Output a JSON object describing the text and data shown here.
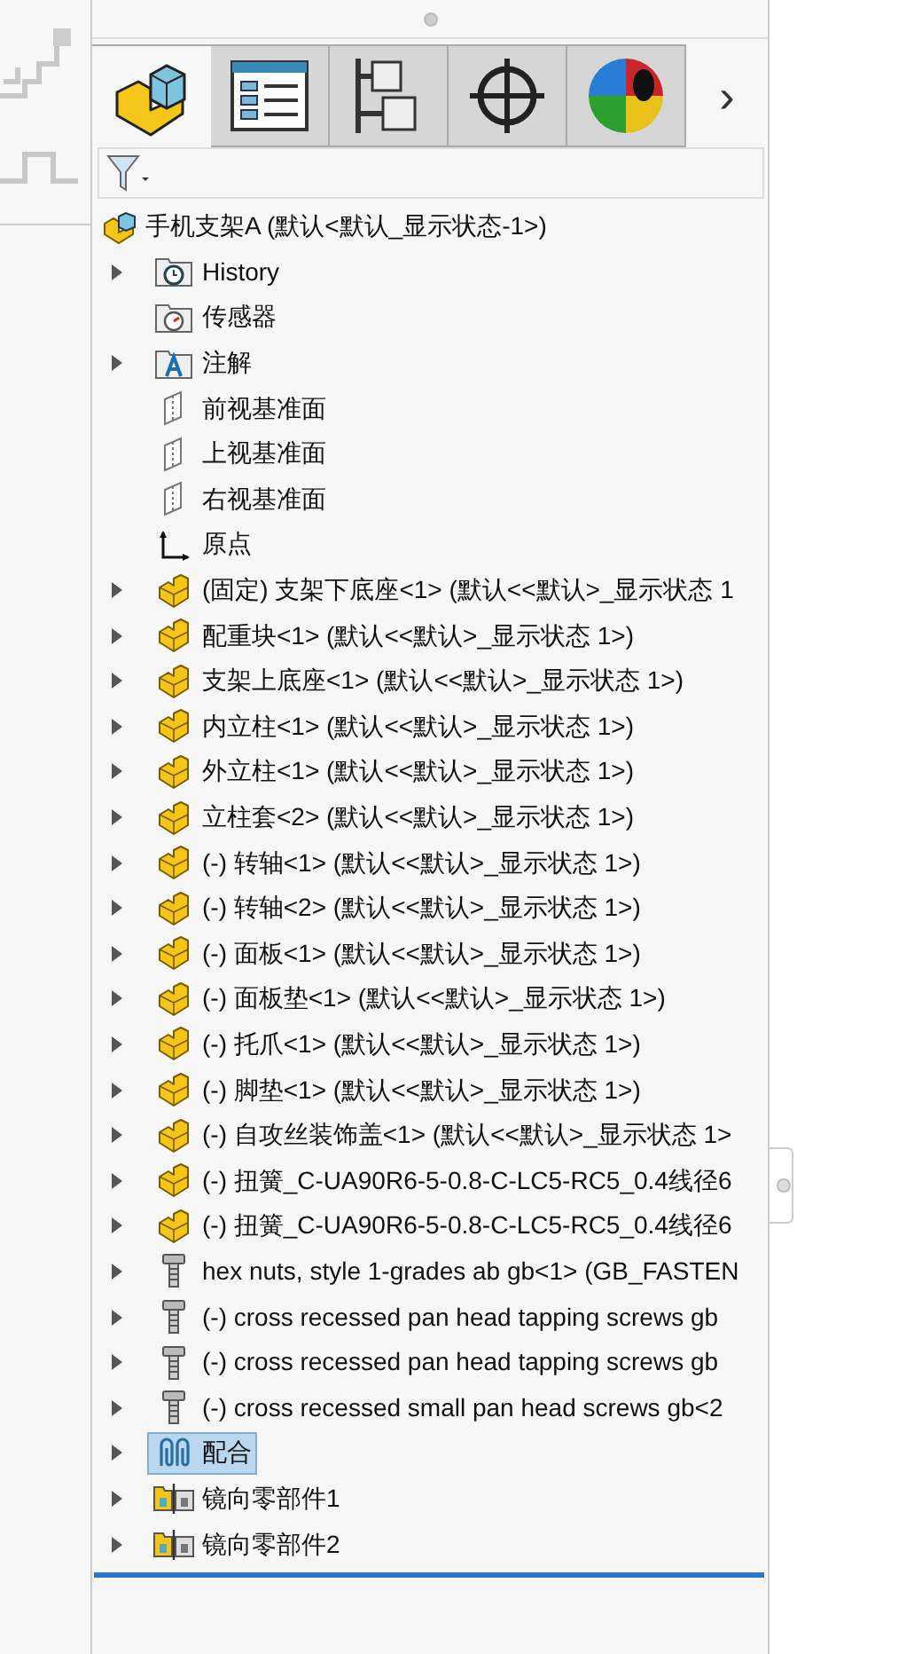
{
  "tabs": [
    {
      "kind": "part",
      "selected": true
    },
    {
      "kind": "list",
      "selected": false
    },
    {
      "kind": "config",
      "selected": false
    },
    {
      "kind": "target",
      "selected": false
    },
    {
      "kind": "appearance",
      "selected": false
    }
  ],
  "more_tabs": "›",
  "tree": {
    "root": {
      "label": "手机支架A  (默认<默认_显示状态-1>)"
    },
    "items": [
      {
        "kind": "history",
        "label": "History",
        "expandable": true,
        "selected": false
      },
      {
        "kind": "sensor",
        "label": "传感器",
        "expandable": false,
        "selected": false
      },
      {
        "kind": "annotation",
        "label": "注解",
        "expandable": true,
        "selected": false
      },
      {
        "kind": "plane",
        "label": "前视基准面",
        "expandable": false,
        "selected": false
      },
      {
        "kind": "plane",
        "label": "上视基准面",
        "expandable": false,
        "selected": false
      },
      {
        "kind": "plane",
        "label": "右视基准面",
        "expandable": false,
        "selected": false
      },
      {
        "kind": "origin",
        "label": "原点",
        "expandable": false,
        "selected": false
      },
      {
        "kind": "part",
        "label": "(固定) 支架下底座<1> (默认<<默认>_显示状态 1",
        "expandable": true,
        "selected": false
      },
      {
        "kind": "part",
        "label": "配重块<1> (默认<<默认>_显示状态 1>)",
        "expandable": true,
        "selected": false
      },
      {
        "kind": "part",
        "label": "支架上底座<1> (默认<<默认>_显示状态 1>)",
        "expandable": true,
        "selected": false
      },
      {
        "kind": "part",
        "label": "内立柱<1> (默认<<默认>_显示状态 1>)",
        "expandable": true,
        "selected": false
      },
      {
        "kind": "part",
        "label": "外立柱<1> (默认<<默认>_显示状态 1>)",
        "expandable": true,
        "selected": false
      },
      {
        "kind": "part",
        "label": "立柱套<2> (默认<<默认>_显示状态 1>)",
        "expandable": true,
        "selected": false
      },
      {
        "kind": "part",
        "label": "(-) 转轴<1> (默认<<默认>_显示状态 1>)",
        "expandable": true,
        "selected": false
      },
      {
        "kind": "part",
        "label": "(-) 转轴<2> (默认<<默认>_显示状态 1>)",
        "expandable": true,
        "selected": false
      },
      {
        "kind": "part",
        "label": "(-) 面板<1> (默认<<默认>_显示状态 1>)",
        "expandable": true,
        "selected": false
      },
      {
        "kind": "part",
        "label": "(-) 面板垫<1> (默认<<默认>_显示状态 1>)",
        "expandable": true,
        "selected": false
      },
      {
        "kind": "part",
        "label": "(-) 托爪<1> (默认<<默认>_显示状态 1>)",
        "expandable": true,
        "selected": false
      },
      {
        "kind": "part",
        "label": "(-) 脚垫<1> (默认<<默认>_显示状态 1>)",
        "expandable": true,
        "selected": false
      },
      {
        "kind": "part",
        "label": "(-) 自攻丝装饰盖<1> (默认<<默认>_显示状态 1>",
        "expandable": true,
        "selected": false
      },
      {
        "kind": "part",
        "label": "(-) 扭簧_C-UA90R6-5-0.8-C-LC5-RC5_0.4线径6",
        "expandable": true,
        "selected": false
      },
      {
        "kind": "part",
        "label": "(-) 扭簧_C-UA90R6-5-0.8-C-LC5-RC5_0.4线径6",
        "expandable": true,
        "selected": false
      },
      {
        "kind": "fastener",
        "label": "hex nuts, style 1-grades ab gb<1> (GB_FASTEN",
        "expandable": true,
        "selected": false
      },
      {
        "kind": "fastener",
        "label": "(-) cross recessed pan head tapping screws gb",
        "expandable": true,
        "selected": false
      },
      {
        "kind": "fastener",
        "label": "(-) cross recessed pan head tapping screws gb",
        "expandable": true,
        "selected": false
      },
      {
        "kind": "fastener",
        "label": "(-) cross recessed small pan head screws gb<2",
        "expandable": true,
        "selected": false
      },
      {
        "kind": "mates",
        "label": "配合",
        "expandable": true,
        "selected": true
      },
      {
        "kind": "mirror",
        "label": "镜向零部件1",
        "expandable": true,
        "selected": false
      },
      {
        "kind": "mirror",
        "label": "镜向零部件2",
        "expandable": true,
        "selected": false
      }
    ]
  }
}
